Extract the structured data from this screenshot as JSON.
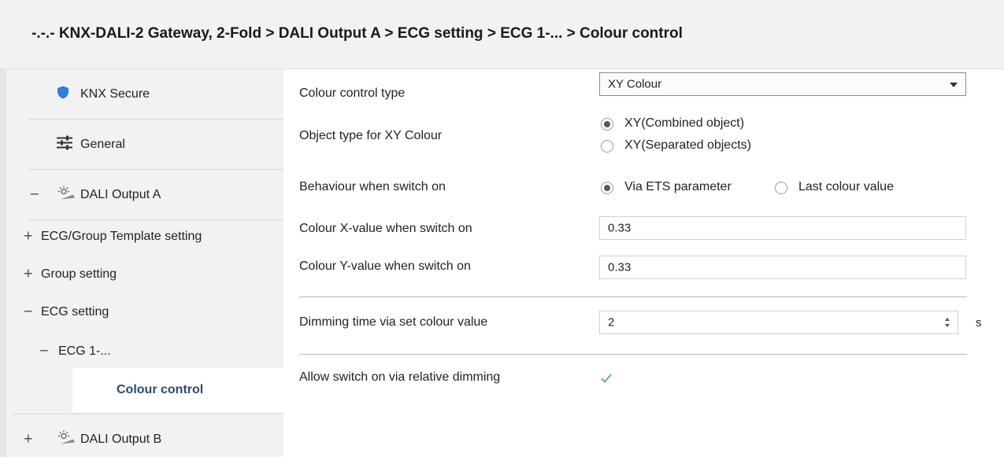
{
  "header": {
    "breadcrumb": "-.-.- KNX-DALI-2 Gateway, 2-Fold > DALI Output A > ECG setting > ECG 1-... > Colour control"
  },
  "sidebar": {
    "items": [
      {
        "label": "KNX Secure",
        "icon": "shield-icon"
      },
      {
        "label": "General",
        "icon": "sliders-icon"
      },
      {
        "label": "DALI Output A",
        "icon": "lamp-icon",
        "expander": "−"
      },
      {
        "label": "ECG/Group Template setting",
        "expander": "+"
      },
      {
        "label": "Group setting",
        "expander": "+"
      },
      {
        "label": "ECG setting",
        "expander": "−"
      },
      {
        "label": "ECG 1-...",
        "expander": "−"
      },
      {
        "label": "Colour control",
        "selected": true
      },
      {
        "label": "DALI Output B",
        "icon": "lamp-icon",
        "expander": "+"
      }
    ]
  },
  "form": {
    "colour_control_type": {
      "label": "Colour control type",
      "value": "XY Colour"
    },
    "object_type": {
      "label": "Object type for XY Colour",
      "options": [
        "XY(Combined object)",
        "XY(Separated objects)"
      ],
      "selected": 0
    },
    "behaviour": {
      "label": "Behaviour when switch on",
      "options": [
        "Via ETS parameter",
        "Last colour value"
      ],
      "selected": 0
    },
    "x_value": {
      "label": "Colour X-value when switch on",
      "value": "0.33"
    },
    "y_value": {
      "label": "Colour Y-value when switch on",
      "value": "0.33"
    },
    "dimming_time": {
      "label": "Dimming time via set colour value",
      "value": "2",
      "unit": "s"
    },
    "allow_switch_on": {
      "label": "Allow switch on via relative dimming",
      "checked": true
    }
  },
  "colors": {
    "accent_blue": "#2f7dd8",
    "selected_text": "#2b4a6f",
    "check_green": "#6fb56f"
  }
}
